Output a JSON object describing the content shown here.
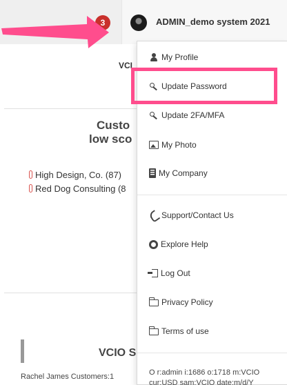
{
  "header": {
    "notification_count": "3",
    "user_name": "ADMIN_demo system 2021"
  },
  "background": {
    "vci_fragment": "VCI",
    "heading_line1": "Custo",
    "heading_line2": "low sco",
    "list": [
      "High Design, Co. (87)",
      "Red Dog Consulting (8"
    ],
    "vcio_fragment": "VCIO S",
    "rachel_line": "Rachel James Customers:1"
  },
  "menu": {
    "items": [
      {
        "label": "My Profile",
        "icon": "user-icon"
      },
      {
        "label": "Update Password",
        "icon": "key-icon"
      },
      {
        "label": "Update 2FA/MFA",
        "icon": "key-icon"
      },
      {
        "label": "My Photo",
        "icon": "photo-icon"
      },
      {
        "label": "My Company",
        "icon": "building-icon"
      },
      {
        "label": "Support/Contact Us",
        "icon": "phone-icon"
      },
      {
        "label": "Explore Help",
        "icon": "lifering-icon"
      },
      {
        "label": "Log Out",
        "icon": "logout-icon"
      },
      {
        "label": "Privacy Policy",
        "icon": "folder-icon"
      },
      {
        "label": "Terms of use",
        "icon": "folder-icon"
      }
    ],
    "footer_line1": "O r:admin i:1686 o:1718 m:VCIO",
    "footer_line2": "cur:USD sam:VCIO date:m/d/Y"
  },
  "colors": {
    "highlight": "#ff4d8d",
    "arrow": "#ff4d8d",
    "badge": "#c9302c"
  }
}
